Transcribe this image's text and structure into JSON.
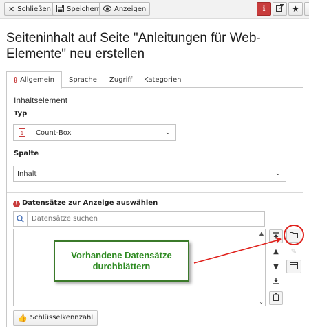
{
  "toolbar": {
    "close_label": "Schließen",
    "save_label": "Speichern",
    "view_label": "Anzeigen",
    "info_symbol": "i"
  },
  "page": {
    "title": "Seiteninhalt auf Seite \"Anleitungen für Web-Elemente\" neu erstellen"
  },
  "tabs": [
    {
      "label": "Allgemein",
      "active": true
    },
    {
      "label": "Sprache"
    },
    {
      "label": "Zugriff"
    },
    {
      "label": "Kategorien"
    }
  ],
  "form": {
    "section_title": "Inhaltselement",
    "typ_label": "Typ",
    "typ_value": "Count-Box",
    "spalte_label": "Spalte",
    "spalte_value": "Inhalt",
    "records_label": "Datensätze zur Anzeige auswählen",
    "search_placeholder": "Datensätze suchen",
    "key_button_label": "Schlüsselkennzahl"
  },
  "annotation": {
    "text": "Vorhandene Datensätze\ndurchblättern"
  },
  "colors": {
    "danger": "#c83c3c",
    "annotation_green": "#2e8b22",
    "arrow_red": "#e0201b",
    "link_blue": "#4a73b8"
  }
}
